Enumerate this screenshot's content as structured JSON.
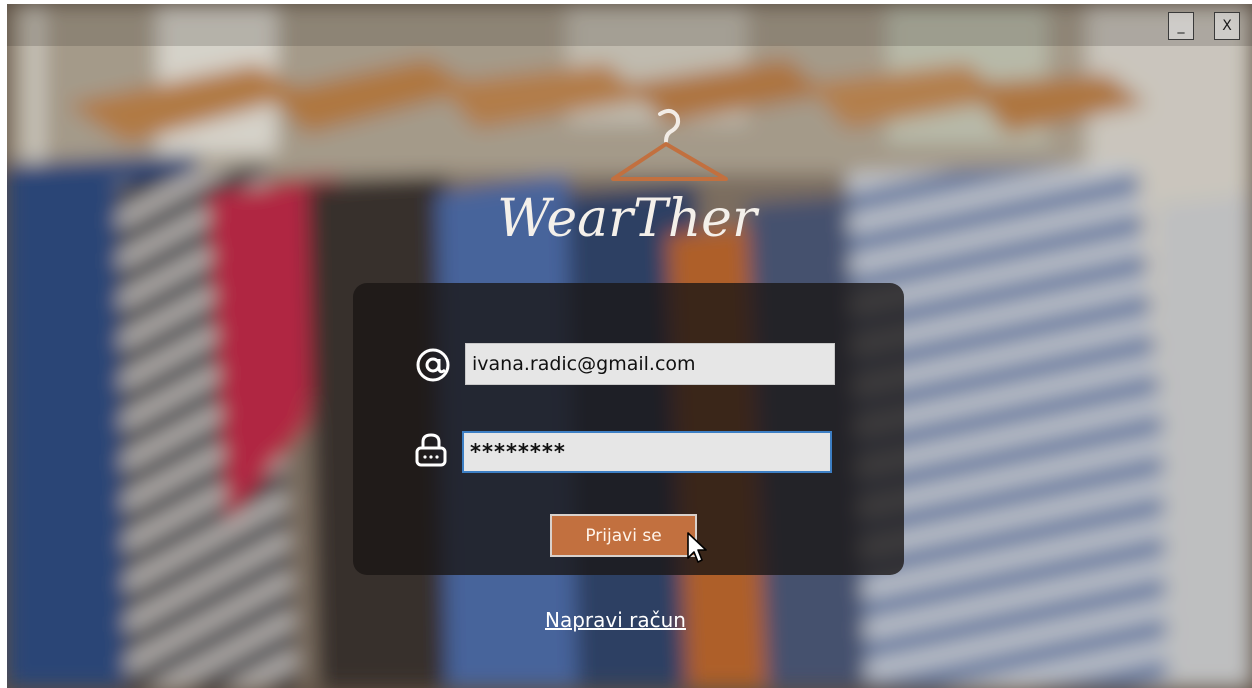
{
  "window": {
    "minimize_label": "_",
    "close_label": "X"
  },
  "brand": {
    "name": "WearTher",
    "accent_color": "#c2703f"
  },
  "login": {
    "email_value": "ivana.radic@gmail.com",
    "password_value": "********",
    "email_icon": "at-icon",
    "password_icon": "lock-icon",
    "submit_label": "Prijavi se",
    "field_focus_color": "#3d7fc4"
  },
  "links": {
    "create_account_label": "Napravi račun"
  }
}
